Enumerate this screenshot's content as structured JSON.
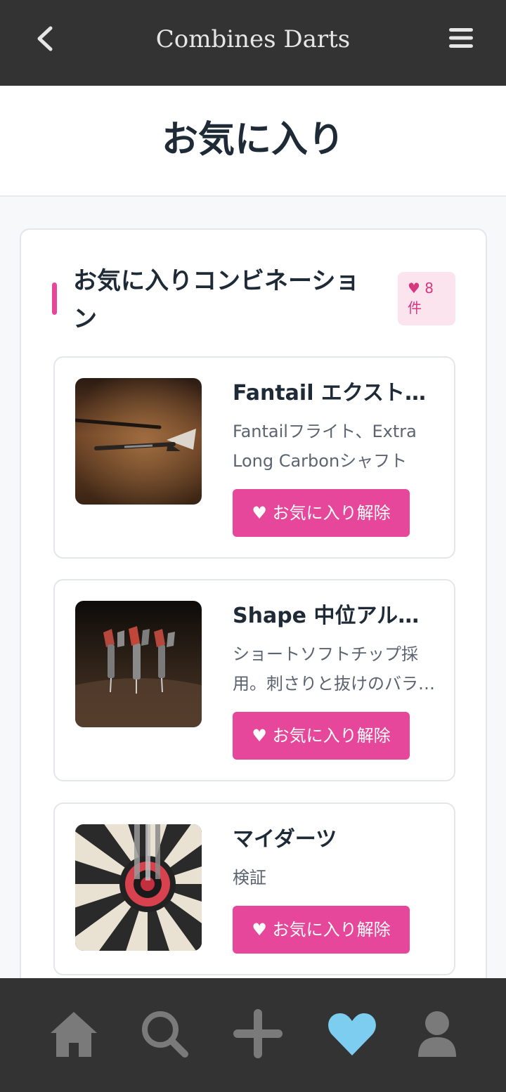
{
  "app": {
    "title": "Combines Darts"
  },
  "header": {
    "back_icon": "chevron-left-icon",
    "menu_icon": "hamburger-menu-icon"
  },
  "page": {
    "title": "お気に入り"
  },
  "section": {
    "title": "お気に入りコンビネーション",
    "count_heart": "♥",
    "count_value": "8",
    "count_unit": "件"
  },
  "favorites": [
    {
      "name": "Fantail エクストラロング",
      "description": "Fantailフライト、Extra Long Carbonシャフト",
      "image_icon": "dart-photo",
      "button_label": "♥ お気に入り解除"
    },
    {
      "name": "Shape 中位アルミシャフト",
      "description": "ショートソフトチップ採用。刺さりと抜けのバランス",
      "image_icon": "darts-row-photo",
      "button_label": "♥ お気に入り解除"
    },
    {
      "name": "マイダーツ",
      "description": "検証",
      "image_icon": "dartboard-photo",
      "button_label": "♥ お気に入り解除"
    }
  ],
  "bottom_nav": [
    {
      "icon": "home-icon",
      "active": false
    },
    {
      "icon": "search-icon",
      "active": false
    },
    {
      "icon": "plus-icon",
      "active": false
    },
    {
      "icon": "heart-icon",
      "active": true
    },
    {
      "icon": "user-icon",
      "active": false
    }
  ],
  "colors": {
    "bar_bg": "#333333",
    "accent": "#e6479a",
    "active_nav": "#7ccdf0",
    "inactive_nav": "#7a7a7a"
  }
}
